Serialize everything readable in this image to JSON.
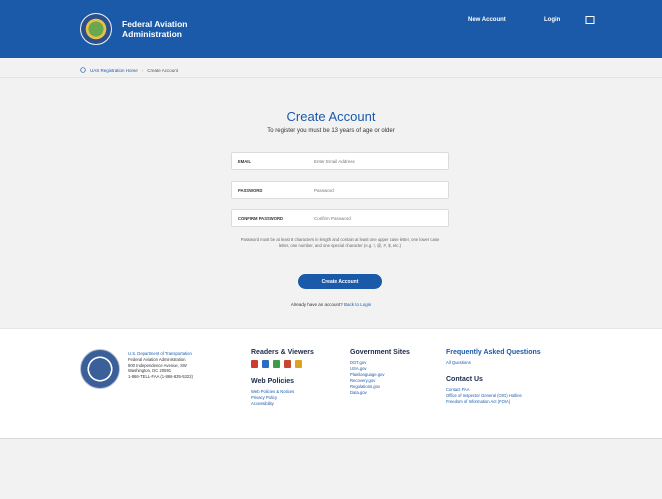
{
  "header": {
    "brand_line1": "Federal Aviation",
    "brand_line2": "Administration",
    "nav_new_account": "New Account",
    "nav_login": "Login"
  },
  "breadcrumb": {
    "home": "UAS Registration Home",
    "sep": "›",
    "current": "Create Account"
  },
  "main": {
    "title": "Create Account",
    "subtitle": "To register you must be 13 years of age or older",
    "fields": [
      {
        "label": "EMAIL",
        "placeholder": "Enter Email Address"
      },
      {
        "label": "PASSWORD",
        "placeholder": "Password"
      },
      {
        "label": "CONFIRM PASSWORD",
        "placeholder": "Confirm Password"
      }
    ],
    "hint": "Password must be at least 8 characters in length and contain at least one upper case letter, one lower case letter, one number, and one special character (e.g. !, @, #, $, etc.)",
    "create_button": "Create Account",
    "have_account": "Already have an account?",
    "back_to_login": "Back to Login"
  },
  "footer": {
    "dot": {
      "name": "U.S. Department of Transportation",
      "agency": "Federal Aviation Administration",
      "address1": "800 Independence Avenue, SW",
      "address2": "Washington, DC 20591",
      "phone": "1-866-TELL-FAA (1-866-835-5322)"
    },
    "readers_title": "Readers & Viewers",
    "reader_icon_colors": [
      "#d03b2f",
      "#2b6cc4",
      "#3f9a47",
      "#c8452e",
      "#d9a520"
    ],
    "policies_title": "Web Policies",
    "policies": [
      "Web Policies & Notices",
      "Privacy Policy",
      "Accessibility"
    ],
    "gov_title": "Government Sites",
    "gov_sites": [
      "DOT.gov",
      "USA.gov",
      "Plainlanguage.gov",
      "Recovery.gov",
      "Regulations.gov",
      "Data.gov"
    ],
    "faq_title": "Frequently Asked Questions",
    "faq_link": "All Questions",
    "contact_title": "Contact Us",
    "contact_links": [
      "Contact FAA",
      "Office of Inspector General (OIG) Hotline",
      "Freedom of Information Act (FOIA)"
    ]
  },
  "colors": {
    "brand": "#1a5aa8"
  }
}
